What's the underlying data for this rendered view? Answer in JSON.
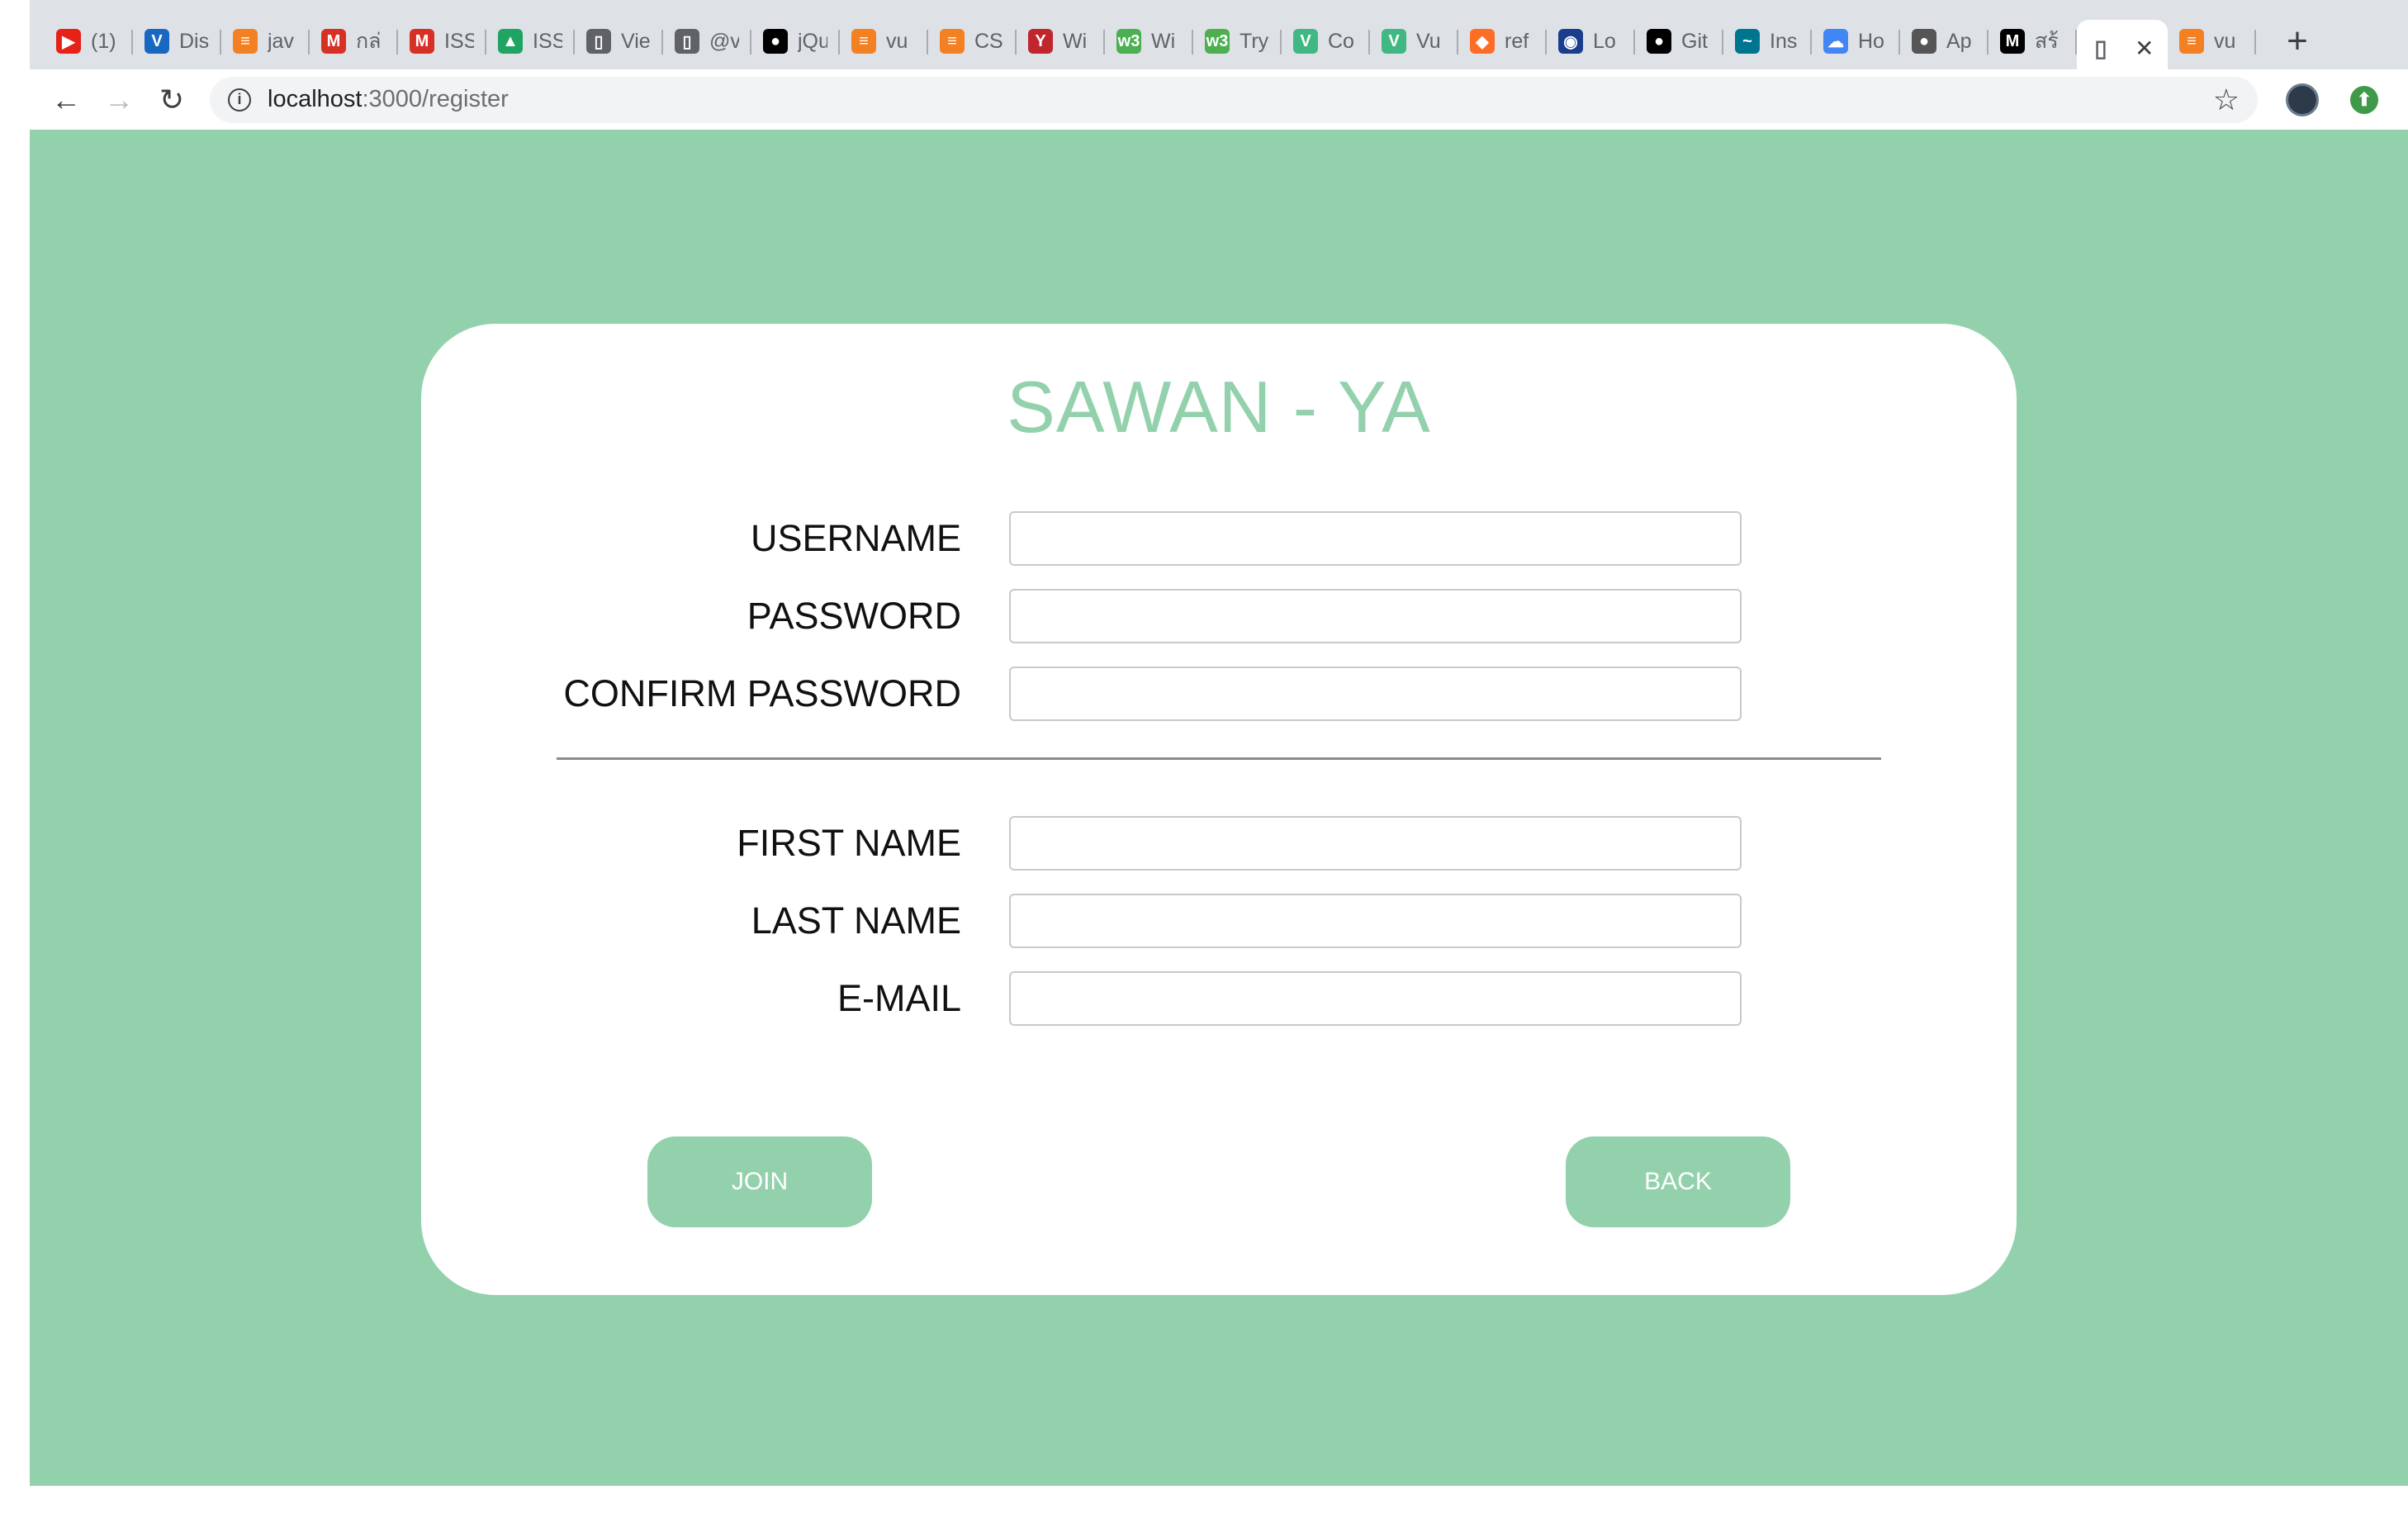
{
  "browser": {
    "tabs": [
      {
        "title": "(1)",
        "icon": "youtube-icon",
        "color": "#e62117",
        "glyph": "▶"
      },
      {
        "title": "Dis",
        "icon": "vuetify-icon",
        "color": "#1867c0",
        "glyph": "V"
      },
      {
        "title": "jav",
        "icon": "stackoverflow-icon",
        "color": "#f48024",
        "glyph": "≡"
      },
      {
        "title": "กล่",
        "icon": "gmail-icon",
        "color": "#d93025",
        "glyph": "M"
      },
      {
        "title": "ISS",
        "icon": "gmail-icon",
        "color": "#d93025",
        "glyph": "M"
      },
      {
        "title": "ISS",
        "icon": "google-drive-icon",
        "color": "#1fa463",
        "glyph": "▲"
      },
      {
        "title": "Vie",
        "icon": "page-icon",
        "color": "#5f6368",
        "glyph": "▯"
      },
      {
        "title": "@v",
        "icon": "page-icon",
        "color": "#5f6368",
        "glyph": "▯"
      },
      {
        "title": "jQu",
        "icon": "github-icon",
        "color": "#000000",
        "glyph": "●"
      },
      {
        "title": "vu",
        "icon": "stackoverflow-icon",
        "color": "#f48024",
        "glyph": "≡"
      },
      {
        "title": "CS",
        "icon": "stackoverflow-icon",
        "color": "#f48024",
        "glyph": "≡"
      },
      {
        "title": "Wi",
        "icon": "radio-tower-icon",
        "color": "#c0262d",
        "glyph": "Y"
      },
      {
        "title": "Wi",
        "icon": "w3schools-icon",
        "color": "#4caf50",
        "glyph": "w3"
      },
      {
        "title": "Try",
        "icon": "w3schools-icon",
        "color": "#4caf50",
        "glyph": "w3"
      },
      {
        "title": "Co",
        "icon": "vue-icon",
        "color": "#41b883",
        "glyph": "V"
      },
      {
        "title": "Vu",
        "icon": "vue-icon",
        "color": "#41b883",
        "glyph": "V"
      },
      {
        "title": "ref",
        "icon": "gitlab-icon",
        "color": "#fc6d26",
        "glyph": "◆"
      },
      {
        "title": "Lo",
        "icon": "globe-icon",
        "color": "#1a3e8c",
        "glyph": "◉"
      },
      {
        "title": "Git",
        "icon": "github-icon",
        "color": "#000000",
        "glyph": "●"
      },
      {
        "title": "Ins",
        "icon": "mysql-icon",
        "color": "#00758f",
        "glyph": "~"
      },
      {
        "title": "Ho",
        "icon": "google-cloud-icon",
        "color": "#4285f4",
        "glyph": "☁"
      },
      {
        "title": "Ap",
        "icon": "apple-icon",
        "color": "#555555",
        "glyph": "●"
      },
      {
        "title": "สร้",
        "icon": "medium-icon",
        "color": "#000000",
        "glyph": "M"
      }
    ],
    "active_tab": {
      "icon": "page-icon",
      "close": "✕"
    },
    "after_tab": {
      "title": "vu",
      "icon": "stackoverflow-icon",
      "color": "#f48024",
      "glyph": "≡"
    },
    "new_tab": "+",
    "url_host": "localhost",
    "url_path": ":3000/register"
  },
  "page": {
    "background": "#93d1ad",
    "brand": "SAWAN - YA",
    "fields": {
      "username": "USERNAME",
      "password": "PASSWORD",
      "confirm_password": "CONFIRM PASSWORD",
      "first_name": "FIRST NAME",
      "last_name": "LAST NAME",
      "email": "E-MAIL"
    },
    "join_label": "JOIN",
    "back_label": "BACK"
  }
}
